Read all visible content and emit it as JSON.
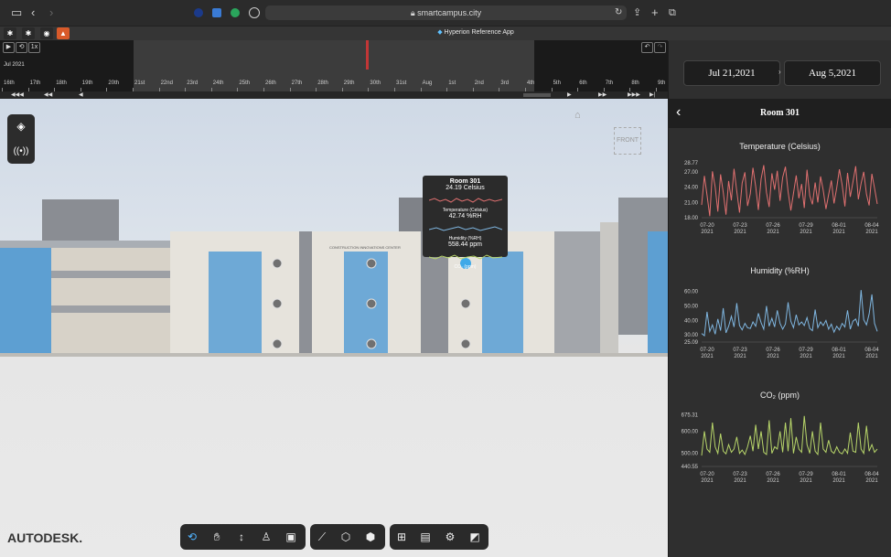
{
  "browser": {
    "url": "smartcampus.city",
    "tab_title": "Hyperion Reference App"
  },
  "timeline": {
    "month_label": "Jul 2021",
    "speed": "1x",
    "ticks": [
      "16th",
      "17th",
      "18th",
      "19th",
      "20th",
      "21st",
      "22nd",
      "23rd",
      "24th",
      "25th",
      "26th",
      "27th",
      "28th",
      "29th",
      "30th",
      "31st",
      "Aug",
      "1st",
      "2nd",
      "3rd",
      "4th",
      "5th",
      "6th",
      "7th",
      "8th",
      "9th"
    ]
  },
  "viewer": {
    "cube_label": "FRONT",
    "building_sign": "CONSTRUCTION INNOVATIONS CENTER",
    "brand": "AUTODESK."
  },
  "tooltip": {
    "room": "Room 301",
    "temp_value": "24.19 Celsius",
    "temp_label": "Temperature (Celsius)",
    "hum_value": "42.74 %RH",
    "hum_label": "Humidity (%RH)",
    "co2_value": "558.44 ppm",
    "co2_label": "CO₂ (ppm)"
  },
  "panel": {
    "date_from": "Jul 21,2021",
    "date_to": "Aug 5,2021",
    "title": "Room 301"
  },
  "chart_data": [
    {
      "type": "line",
      "title": "Temperature (Celsius)",
      "color": "#e07070",
      "ylim": [
        18.0,
        28.77
      ],
      "yticks": [
        "28.77",
        "27.00",
        "24.00",
        "21.00",
        "18.00"
      ],
      "xticks": [
        "07-20\n2021",
        "07-23\n2021",
        "07-26\n2021",
        "07-29\n2021",
        "08-01\n2021",
        "08-04\n2021"
      ],
      "values": [
        20.5,
        26.2,
        22.4,
        18.3,
        27.1,
        24.0,
        19.2,
        26.5,
        23.0,
        18.6,
        25.2,
        21.4,
        27.6,
        23.2,
        19.0,
        24.8,
        26.9,
        20.3,
        22.7,
        27.8,
        24.1,
        19.5,
        25.6,
        28.3,
        22.9,
        20.1,
        26.7,
        23.5,
        27.2,
        21.3,
        25.9,
        28.0,
        23.1,
        19.4,
        22.8,
        26.3,
        21.8,
        24.6,
        19.9,
        27.4,
        22.3,
        20.6,
        24.9,
        21.0,
        26.1,
        23.4,
        19.7,
        22.5,
        25.3,
        20.8,
        23.9,
        27.5,
        24.4,
        20.2,
        26.8,
        22.1,
        25.0,
        28.1,
        21.6,
        24.7,
        27.0,
        22.6,
        20.4,
        26.6,
        23.8,
        20.7
      ]
    },
    {
      "type": "line",
      "title": "Humidity (%RH)",
      "color": "#7fb6e0",
      "ylim": [
        25.09,
        63.0
      ],
      "yticks": [
        "60.00",
        "50.00",
        "40.00",
        "30.00",
        "25.09"
      ],
      "xticks": [
        "07-20\n2021",
        "07-23\n2021",
        "07-26\n2021",
        "07-29\n2021",
        "08-01\n2021",
        "08-04\n2021"
      ],
      "values": [
        31.0,
        29.5,
        46.0,
        32.5,
        37.0,
        30.5,
        41.0,
        33.0,
        48.5,
        31.5,
        36.0,
        43.0,
        35.5,
        52.0,
        36.5,
        33.5,
        38.0,
        35.0,
        34.5,
        39.0,
        36.0,
        45.0,
        38.5,
        34.0,
        50.0,
        36.0,
        41.5,
        35.5,
        47.0,
        38.0,
        34.0,
        37.5,
        52.5,
        39.5,
        35.0,
        44.0,
        37.0,
        39.0,
        36.5,
        42.0,
        34.5,
        33.0,
        47.5,
        35.0,
        39.0,
        36.5,
        40.0,
        34.0,
        37.5,
        32.0,
        36.0,
        33.5,
        38.0,
        35.5,
        47.0,
        34.0,
        39.5,
        41.0,
        36.0,
        61.0,
        40.5,
        37.0,
        44.5,
        58.0,
        38.0,
        32.5
      ]
    },
    {
      "type": "line",
      "title": "CO₂ (ppm)",
      "color": "#b8d66a",
      "ylim": [
        440.55,
        690.0
      ],
      "yticks": [
        "675.31",
        "600.00",
        "500.00",
        "440.55"
      ],
      "xticks": [
        "07-20\n2021",
        "07-23\n2021",
        "07-26\n2021",
        "07-29\n2021",
        "08-01\n2021",
        "08-04\n2021"
      ],
      "values": [
        490,
        600,
        520,
        505,
        640,
        530,
        500,
        590,
        510,
        498,
        540,
        505,
        520,
        575,
        500,
        515,
        495,
        530,
        580,
        510,
        630,
        520,
        600,
        505,
        495,
        650,
        500,
        530,
        520,
        600,
        505,
        640,
        510,
        660,
        500,
        575,
        520,
        505,
        670,
        540,
        500,
        600,
        510,
        495,
        640,
        520,
        505,
        560,
        510,
        500,
        530,
        505,
        498,
        520,
        500,
        595,
        510,
        505,
        640,
        520,
        500,
        625,
        510,
        540,
        505,
        520
      ]
    }
  ]
}
